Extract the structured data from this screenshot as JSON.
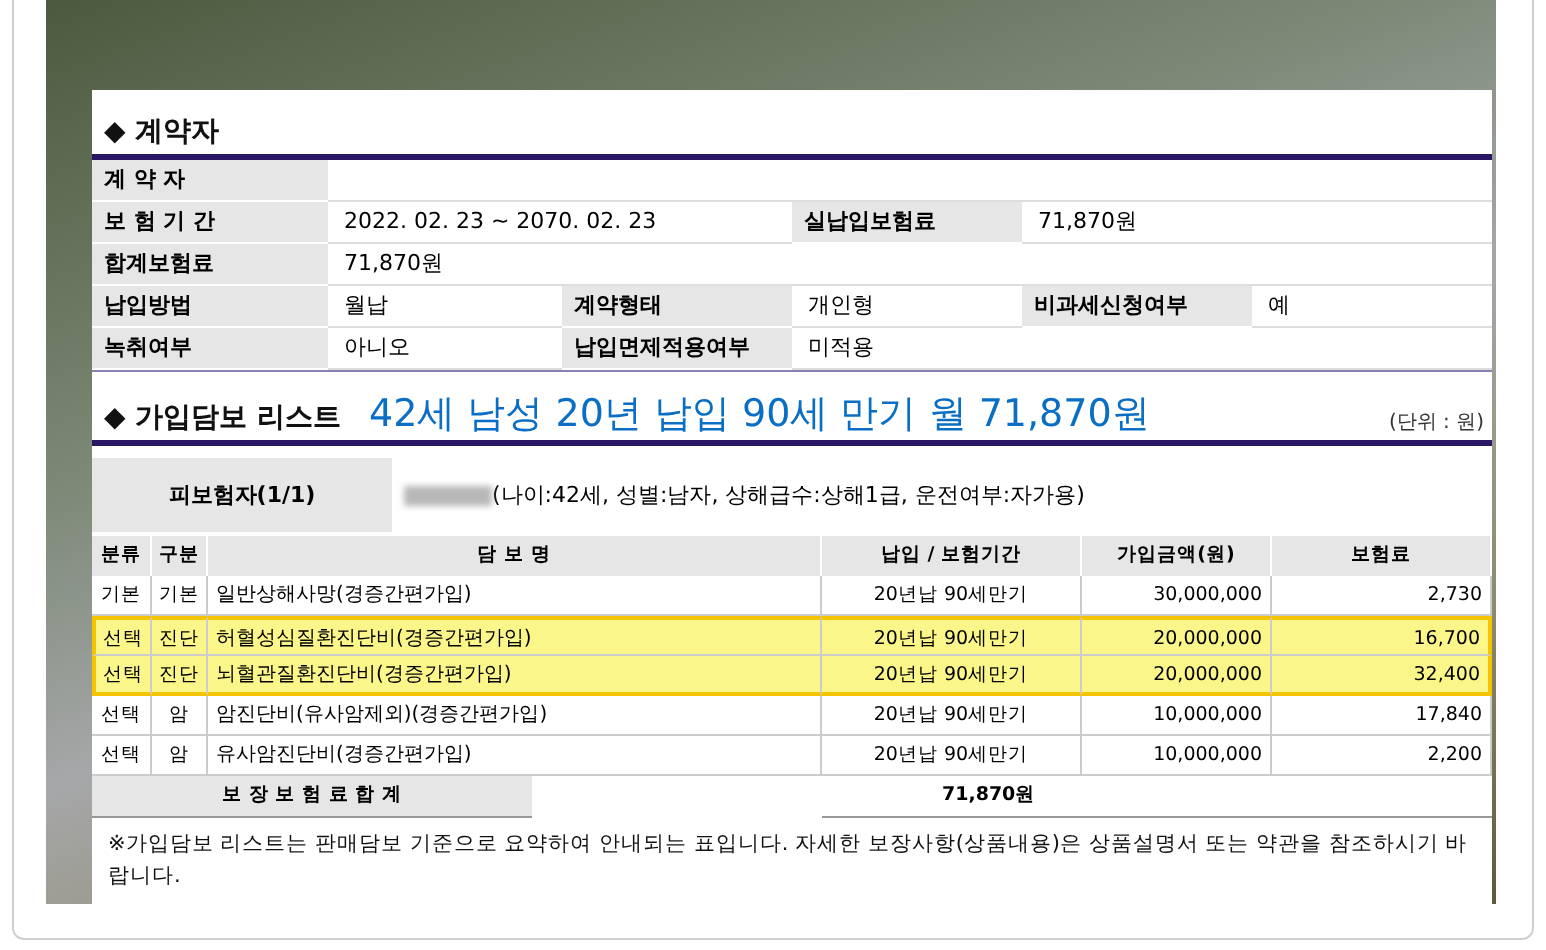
{
  "contract": {
    "title": "◆ 계약자",
    "rows": [
      [
        {
          "label": "계 약 자"
        }
      ],
      [
        {
          "label": "보 험 기 간",
          "value": "2022. 02. 23 ~ 2070. 02. 23"
        },
        {
          "label": "실납입보험료",
          "value": "71,870원"
        }
      ],
      [
        {
          "label": "합계보험료",
          "value": "71,870원"
        }
      ],
      [
        {
          "label": "납입방법",
          "value": "월납"
        },
        {
          "label": "계약형태",
          "value": "개인형"
        },
        {
          "label": "비과세신청여부",
          "value": "예"
        }
      ],
      [
        {
          "label": "녹취여부",
          "value": "아니오"
        },
        {
          "label": "납입면제적용여부",
          "value": "미적용"
        }
      ]
    ]
  },
  "coverage": {
    "title": "◆ 가입담보 리스트",
    "headline": "42세 남성 20년 납입 90세 만기 월 71,870원",
    "unit": "(단위 :  원)",
    "insured_label": "피보험자(1/1)",
    "insured_info": "(나이:42세, 성별:남자, 상해급수:상해1급, 운전여부:자가용)",
    "columns": [
      "분류",
      "구분",
      "담 보 명",
      "납입 / 보험기간",
      "가입금액(원)",
      "보험료"
    ],
    "rows": [
      {
        "cells": [
          "기본",
          "기본",
          "일반상해사망(경증간편가입)",
          "20년납 90세만기",
          "30,000,000",
          "2,730"
        ],
        "highlighted": false
      },
      {
        "cells": [
          "선택",
          "진단",
          "허혈성심질환진단비(경증간편가입)",
          "20년납 90세만기",
          "20,000,000",
          "16,700"
        ],
        "highlighted": true
      },
      {
        "cells": [
          "선택",
          "진단",
          "뇌혈관질환진단비(경증간편가입)",
          "20년납 90세만기",
          "20,000,000",
          "32,400"
        ],
        "highlighted": true
      },
      {
        "cells": [
          "선택",
          "암",
          "암진단비(유사암제외)(경증간편가입)",
          "20년납 90세만기",
          "10,000,000",
          "17,840"
        ],
        "highlighted": false
      },
      {
        "cells": [
          "선택",
          "암",
          "유사암진단비(경증간편가입)",
          "20년납 90세만기",
          "10,000,000",
          "2,200"
        ],
        "highlighted": false
      }
    ],
    "total_label": "보 장 보 험 료  합 계",
    "total_value": "71,870원"
  },
  "note": "※가입담보 리스트는 판매담보 기준으로 요약하여 안내되는 표입니다. 자세한 보장사항(상품내용)은 상품설명서 또는 약관을 참조하시기 바랍니다."
}
